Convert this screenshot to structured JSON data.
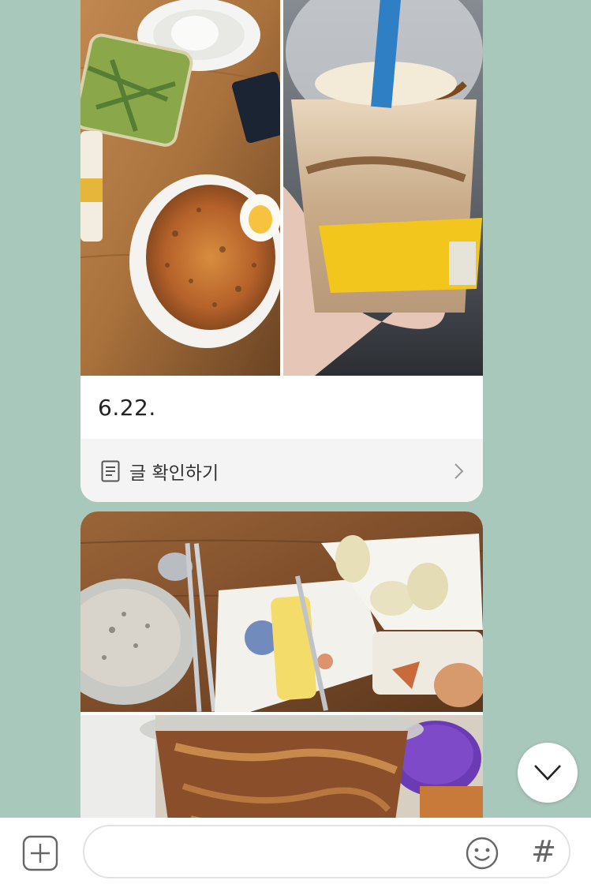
{
  "post": {
    "date": "6.22.",
    "view_post_label": "글 확인하기"
  },
  "photos": [
    {
      "description_icon": "food-plate-photo"
    },
    {
      "description_icon": "iced-drink-photo"
    },
    {
      "description_icon": "breakfast-table-photo"
    },
    {
      "description_icon": "drink-cup-photo"
    }
  ],
  "composer": {
    "placeholder": "",
    "hash_label": "#"
  },
  "icons": {
    "add": "plus-icon",
    "emoji": "smiley-icon",
    "scroll": "chevron-down-icon",
    "doc": "document-icon",
    "arrow": "chevron-right-icon"
  },
  "colors": {
    "background": "#a8c8bb",
    "card": "#ffffff",
    "bar": "#f4f4f4"
  }
}
